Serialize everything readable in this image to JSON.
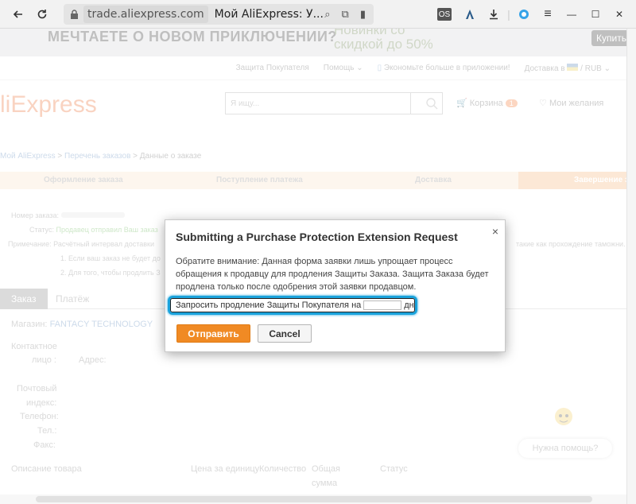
{
  "browser": {
    "domain": "trade.aliexpress.com",
    "page_title": "Мой AliExpress: У..."
  },
  "promo": {
    "headline": "МЕЧТАЕТЕ О НОВОМ ПРИКЛЮЧЕНИИ?",
    "offer_line1": "Новинки со",
    "offer_line2": "скидкой до 50%",
    "button": "Купить"
  },
  "topnav": {
    "buyer_protection": "Защита Покупателя",
    "help": "Помощь ⌄",
    "app": "Экономьте больше в приложении!",
    "ship_to": "Доставка в",
    "currency": "/ RUB ⌄"
  },
  "header": {
    "logo": "liExpress",
    "search_placeholder": "Я ищу...",
    "cart_label": "Корзина",
    "cart_count": "1",
    "wishlist_label": "Мои желания"
  },
  "breadcrumb": {
    "item1": "Мой AliExpress",
    "sep1": " > ",
    "item2": "Перечень заказов",
    "sep2": " > ",
    "item3": "Данные о заказе"
  },
  "steps": [
    "Оформление заказа",
    "Поступление платежа",
    "Доставка",
    "Завершение з"
  ],
  "order": {
    "number_label": "Номер заказа:",
    "status_label": "Статус:",
    "status_value": "Продавец отправил Ваш заказ",
    "note_label": "Примечание:",
    "note_value": "Расчётный интервал доставки",
    "note_right": "такие как прохождение таможни.",
    "item1": "1. Если ваш заказ не будет до",
    "item2": "2. Для того, чтобы продлить З"
  },
  "tabs": {
    "order": "Заказ",
    "payment": "Платёж"
  },
  "shop": {
    "label": "Магазин:",
    "name": "FANTACY TECHNOLOGY"
  },
  "contact": {
    "contact_label": "Контактное",
    "face_label": "лицо :",
    "address_label": "Адрес:",
    "postal_label": "Почтовый",
    "index_label": "индекс:",
    "phone_label": "Телефон:",
    "tel_label": "Тел.:",
    "fax_label": "Факс:"
  },
  "help_button": "Нужна помощь?",
  "table_headers": {
    "description": "Описание товара",
    "unit_price": "Цена за единицу",
    "quantity": "Количество",
    "total1": "Общая",
    "total2": "сумма",
    "status": "Статус"
  },
  "modal": {
    "title": "Submitting a Purchase Protection Extension Request",
    "note": "Обратите внимание: Данная форма заявки лишь упрощает процесс обращения к продавцу для продления Защиты Заказа. Защита Заказа будет продлена только после одобрения этой заявки продавцом.",
    "field_label": "Запросить продление Защиты Покупателя на",
    "days_value": "",
    "days_suffix": "дн",
    "submit": "Отправить",
    "cancel": "Cancel",
    "close": "×"
  }
}
